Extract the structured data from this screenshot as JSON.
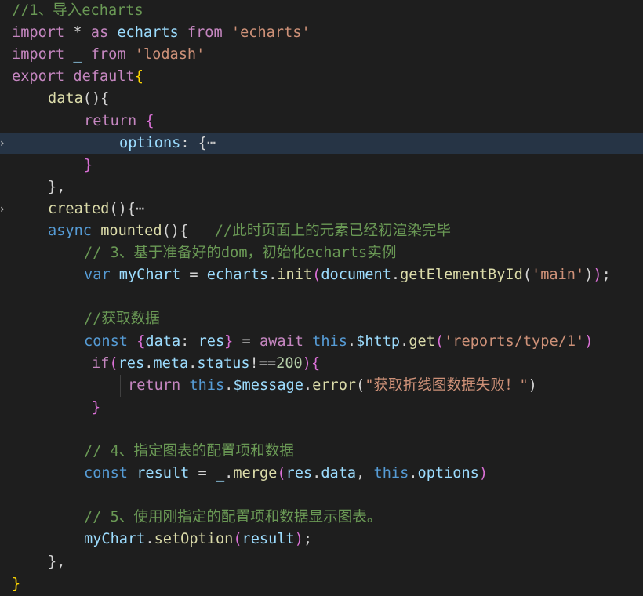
{
  "editor": {
    "language": "javascript",
    "current_line": 7,
    "colors": {
      "background": "#1e1e1e",
      "current_line": "#263445",
      "comment": "#6a9955",
      "keyword": "#c586c0",
      "storage": "#569cd6",
      "variable": "#9cdcfe",
      "function": "#dcdcaa",
      "string": "#ce9178",
      "number": "#b5cea8"
    },
    "lines": [
      {
        "n": 1,
        "tokens": [
          [
            "//1、导入echarts",
            "comment"
          ]
        ]
      },
      {
        "n": 2,
        "tokens": [
          [
            "import",
            "kw"
          ],
          [
            " * ",
            "punc"
          ],
          [
            "as",
            "kw"
          ],
          [
            " echarts ",
            "var"
          ],
          [
            "from",
            "kw"
          ],
          [
            " ",
            "punc"
          ],
          [
            "'echarts'",
            "str"
          ]
        ]
      },
      {
        "n": 3,
        "tokens": [
          [
            "import",
            "kw"
          ],
          [
            " _ ",
            "var"
          ],
          [
            "from",
            "kw"
          ],
          [
            " ",
            "punc"
          ],
          [
            "'lodash'",
            "str"
          ]
        ]
      },
      {
        "n": 4,
        "tokens": [
          [
            "export",
            "kw"
          ],
          [
            " ",
            "punc"
          ],
          [
            "default",
            "kw"
          ],
          [
            "{",
            "brace"
          ]
        ]
      },
      {
        "n": 5,
        "tokens": [
          [
            "data",
            "fn"
          ],
          [
            "(){",
            "punc"
          ]
        ]
      },
      {
        "n": 6,
        "tokens": [
          [
            "return",
            "kw"
          ],
          [
            " ",
            "punc"
          ],
          [
            "{",
            "paren"
          ]
        ]
      },
      {
        "n": 7,
        "tokens": [
          [
            "options",
            "var"
          ],
          [
            ": {",
            "punc"
          ],
          [
            "⋯",
            "fold"
          ]
        ],
        "folded": true
      },
      {
        "n": 8,
        "tokens": [
          [
            "}",
            "paren"
          ]
        ]
      },
      {
        "n": 9,
        "tokens": [
          [
            "},",
            "punc"
          ]
        ]
      },
      {
        "n": 10,
        "tokens": [
          [
            "created",
            "fn"
          ],
          [
            "(){",
            "punc"
          ],
          [
            "⋯",
            "fold"
          ]
        ],
        "folded": true
      },
      {
        "n": 11,
        "tokens": [
          [
            "async",
            "st"
          ],
          [
            " ",
            "punc"
          ],
          [
            "mounted",
            "fn"
          ],
          [
            "(){   ",
            "punc"
          ],
          [
            "//此时页面上的元素已经初渲染完毕",
            "comment"
          ]
        ]
      },
      {
        "n": 12,
        "tokens": [
          [
            "// 3、基于准备好的dom，初始化echarts实例",
            "comment"
          ]
        ]
      },
      {
        "n": 13,
        "tokens": [
          [
            "var",
            "st"
          ],
          [
            " ",
            "punc"
          ],
          [
            "myChart",
            "var"
          ],
          [
            " = ",
            "punc"
          ],
          [
            "echarts",
            "var"
          ],
          [
            ".",
            "punc"
          ],
          [
            "init",
            "fn"
          ],
          [
            "(",
            "paren"
          ],
          [
            "document",
            "var"
          ],
          [
            ".",
            "punc"
          ],
          [
            "getElementById",
            "fn"
          ],
          [
            "(",
            "punc"
          ],
          [
            "'main'",
            "str"
          ],
          [
            ")",
            "punc"
          ],
          [
            ")",
            "paren"
          ],
          [
            ";",
            "punc"
          ]
        ]
      },
      {
        "n": 14,
        "tokens": []
      },
      {
        "n": 15,
        "tokens": [
          [
            "//获取数据",
            "comment"
          ]
        ]
      },
      {
        "n": 16,
        "tokens": [
          [
            "const",
            "st"
          ],
          [
            " ",
            "punc"
          ],
          [
            "{",
            "paren"
          ],
          [
            "data",
            "var"
          ],
          [
            ": ",
            "punc"
          ],
          [
            "res",
            "var"
          ],
          [
            "}",
            "paren"
          ],
          [
            " = ",
            "punc"
          ],
          [
            "await",
            "kw"
          ],
          [
            " ",
            "punc"
          ],
          [
            "this",
            "st"
          ],
          [
            ".",
            "punc"
          ],
          [
            "$http",
            "var"
          ],
          [
            ".",
            "punc"
          ],
          [
            "get",
            "fn"
          ],
          [
            "(",
            "paren"
          ],
          [
            "'reports/type/1'",
            "str"
          ],
          [
            ")",
            "paren"
          ]
        ]
      },
      {
        "n": 17,
        "tokens": [
          [
            "if",
            "kw"
          ],
          [
            "(",
            "paren"
          ],
          [
            "res",
            "var"
          ],
          [
            ".",
            "punc"
          ],
          [
            "meta",
            "var"
          ],
          [
            ".",
            "punc"
          ],
          [
            "status",
            "var"
          ],
          [
            "!==",
            "punc"
          ],
          [
            "200",
            "num"
          ],
          [
            ")",
            "paren"
          ],
          [
            "{",
            "paren"
          ]
        ]
      },
      {
        "n": 18,
        "tokens": [
          [
            "return",
            "kw"
          ],
          [
            " ",
            "punc"
          ],
          [
            "this",
            "st"
          ],
          [
            ".",
            "punc"
          ],
          [
            "$message",
            "var"
          ],
          [
            ".",
            "punc"
          ],
          [
            "error",
            "fn"
          ],
          [
            "(",
            "punc"
          ],
          [
            "\"获取折线图数据失败！\"",
            "str"
          ],
          [
            ")",
            "punc"
          ]
        ]
      },
      {
        "n": 19,
        "tokens": [
          [
            "}",
            "paren"
          ]
        ]
      },
      {
        "n": 20,
        "tokens": []
      },
      {
        "n": 21,
        "tokens": [
          [
            "// 4、指定图表的配置项和数据",
            "comment"
          ]
        ]
      },
      {
        "n": 22,
        "tokens": [
          [
            "const",
            "st"
          ],
          [
            " ",
            "punc"
          ],
          [
            "result",
            "var"
          ],
          [
            " = ",
            "punc"
          ],
          [
            "_",
            "var"
          ],
          [
            ".",
            "punc"
          ],
          [
            "merge",
            "fn"
          ],
          [
            "(",
            "paren"
          ],
          [
            "res",
            "var"
          ],
          [
            ".",
            "punc"
          ],
          [
            "data",
            "var"
          ],
          [
            ", ",
            "punc"
          ],
          [
            "this",
            "st"
          ],
          [
            ".",
            "punc"
          ],
          [
            "options",
            "var"
          ],
          [
            ")",
            "paren"
          ]
        ]
      },
      {
        "n": 23,
        "tokens": []
      },
      {
        "n": 24,
        "tokens": [
          [
            "// 5、使用刚指定的配置项和数据显示图表。",
            "comment"
          ]
        ]
      },
      {
        "n": 25,
        "tokens": [
          [
            "myChart",
            "var"
          ],
          [
            ".",
            "punc"
          ],
          [
            "setOption",
            "fn"
          ],
          [
            "(",
            "paren"
          ],
          [
            "result",
            "var"
          ],
          [
            ")",
            "paren"
          ],
          [
            ";",
            "punc"
          ]
        ]
      },
      {
        "n": 26,
        "tokens": [
          [
            "},",
            "punc"
          ]
        ]
      },
      {
        "n": 27,
        "tokens": [
          [
            "}",
            "brace"
          ]
        ]
      }
    ]
  }
}
